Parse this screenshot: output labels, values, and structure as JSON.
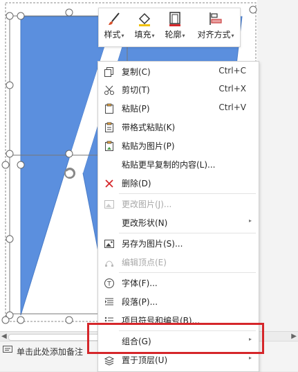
{
  "mini_toolbar": {
    "buttons": [
      {
        "label": "样式",
        "icon": "brush-icon"
      },
      {
        "label": "填充",
        "icon": "fill-bucket-icon"
      },
      {
        "label": "轮廓",
        "icon": "outline-icon"
      },
      {
        "label": "对齐方式",
        "icon": "align-icon"
      }
    ]
  },
  "context_menu": {
    "items": [
      {
        "label": "复制(C)",
        "shortcut": "Ctrl+C",
        "icon": "copy-icon",
        "enabled": true
      },
      {
        "label": "剪切(T)",
        "shortcut": "Ctrl+X",
        "icon": "scissors-icon",
        "enabled": true
      },
      {
        "label": "粘贴(P)",
        "shortcut": "Ctrl+V",
        "icon": "paste-icon",
        "enabled": true
      },
      {
        "label": "带格式粘贴(K)",
        "shortcut": "",
        "icon": "paste-format-icon",
        "enabled": true
      },
      {
        "label": "粘贴为图片(P)",
        "shortcut": "",
        "icon": "paste-image-icon",
        "enabled": true
      },
      {
        "label": "粘贴更早复制的内容(L)...",
        "shortcut": "",
        "icon": "",
        "enabled": true
      },
      {
        "label": "删除(D)",
        "shortcut": "",
        "icon": "delete-x-icon",
        "enabled": true
      },
      {
        "label": "更改图片(J)...",
        "shortcut": "",
        "icon": "change-image-icon",
        "enabled": false
      },
      {
        "label": "更改形状(N)",
        "shortcut": "",
        "icon": "",
        "enabled": true,
        "submenu": true
      },
      {
        "label": "另存为图片(S)...",
        "shortcut": "",
        "icon": "save-image-icon",
        "enabled": true
      },
      {
        "label": "编辑顶点(E)",
        "shortcut": "",
        "icon": "edit-points-icon",
        "enabled": false
      },
      {
        "label": "字体(F)...",
        "shortcut": "",
        "icon": "font-icon",
        "enabled": true
      },
      {
        "label": "段落(P)...",
        "shortcut": "",
        "icon": "paragraph-icon",
        "enabled": true
      },
      {
        "label": "项目符号和编号(B)...",
        "shortcut": "",
        "icon": "bullets-icon",
        "enabled": true
      },
      {
        "label": "组合(G)",
        "shortcut": "",
        "icon": "",
        "enabled": true,
        "submenu": true
      },
      {
        "label": "置于顶层(U)",
        "shortcut": "",
        "icon": "bring-front-icon",
        "enabled": true,
        "submenu": true
      }
    ]
  },
  "notes": {
    "placeholder": "单击此处添加备注"
  },
  "colors": {
    "shape_fill": "#5b8fde",
    "highlight": "#d5262a"
  }
}
